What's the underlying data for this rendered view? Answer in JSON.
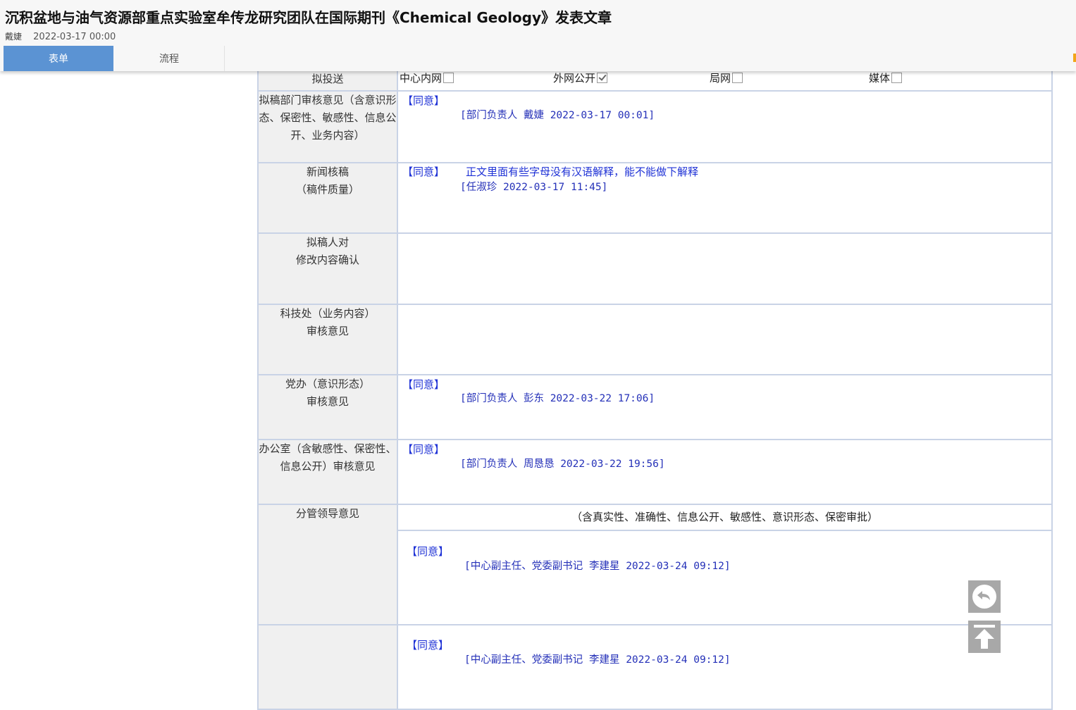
{
  "header": {
    "title": "沉积盆地与油气资源部重点实验室牟传龙研究团队在国际期刊《Chemical Geology》发表文章",
    "author": "戴婕",
    "datetime": "2022-03-17 00:00"
  },
  "tabs": [
    {
      "label": "表单",
      "active": true
    },
    {
      "label": "流程",
      "active": false
    }
  ],
  "publish": {
    "label": "拟投送",
    "options": [
      {
        "label": "中心内网",
        "checked": false
      },
      {
        "label": "外网公开",
        "checked": true
      },
      {
        "label": "局网",
        "checked": false
      },
      {
        "label": "媒体",
        "checked": false
      }
    ]
  },
  "rows": {
    "dept_review": {
      "label": "拟稿部门审核意见（含意识形态、保密性、敏感性、信息公开、业务内容）",
      "agree": "【同意】",
      "sign": "[部门负责人 戴婕 2022-03-17 00:01]"
    },
    "news_review": {
      "label_1": "新闻核稿",
      "label_2": "（稿件质量）",
      "agree": "【同意】",
      "comment": "正文里面有些字母没有汉语解释，能不能做下解释",
      "sign": "[任淑珍 2022-03-17 11:45]"
    },
    "drafter_confirm": {
      "label_1": "拟稿人对",
      "label_2": "修改内容确认"
    },
    "tech_review": {
      "label_1": "科技处（业务内容）",
      "label_2": "审核意见"
    },
    "party_review": {
      "label_1": "党办（意识形态）",
      "label_2": "审核意见",
      "agree": "【同意】",
      "sign": "[部门负责人 彭东 2022-03-22 17:06]"
    },
    "office_review": {
      "label": "办公室（含敏感性、保密性、信息公开）审核意见",
      "agree": "【同意】",
      "sign": "[部门负责人 周恳恳 2022-03-22 19:56]"
    },
    "leader_review": {
      "label": "分管领导意见",
      "caption": "（含真实性、准确性、信息公开、敏感性、意识形态、保密审批）",
      "agree": "【同意】",
      "sign": "[中心副主任、党委副书记 李建星 2022-03-24 09:12]"
    },
    "next_review": {
      "agree": "【同意】",
      "sign": "[中心副主任、党委副书记 李建星 2022-03-24 09:12]"
    }
  },
  "icons": {
    "back": "back-arrow-icon",
    "top": "back-to-top-icon"
  }
}
